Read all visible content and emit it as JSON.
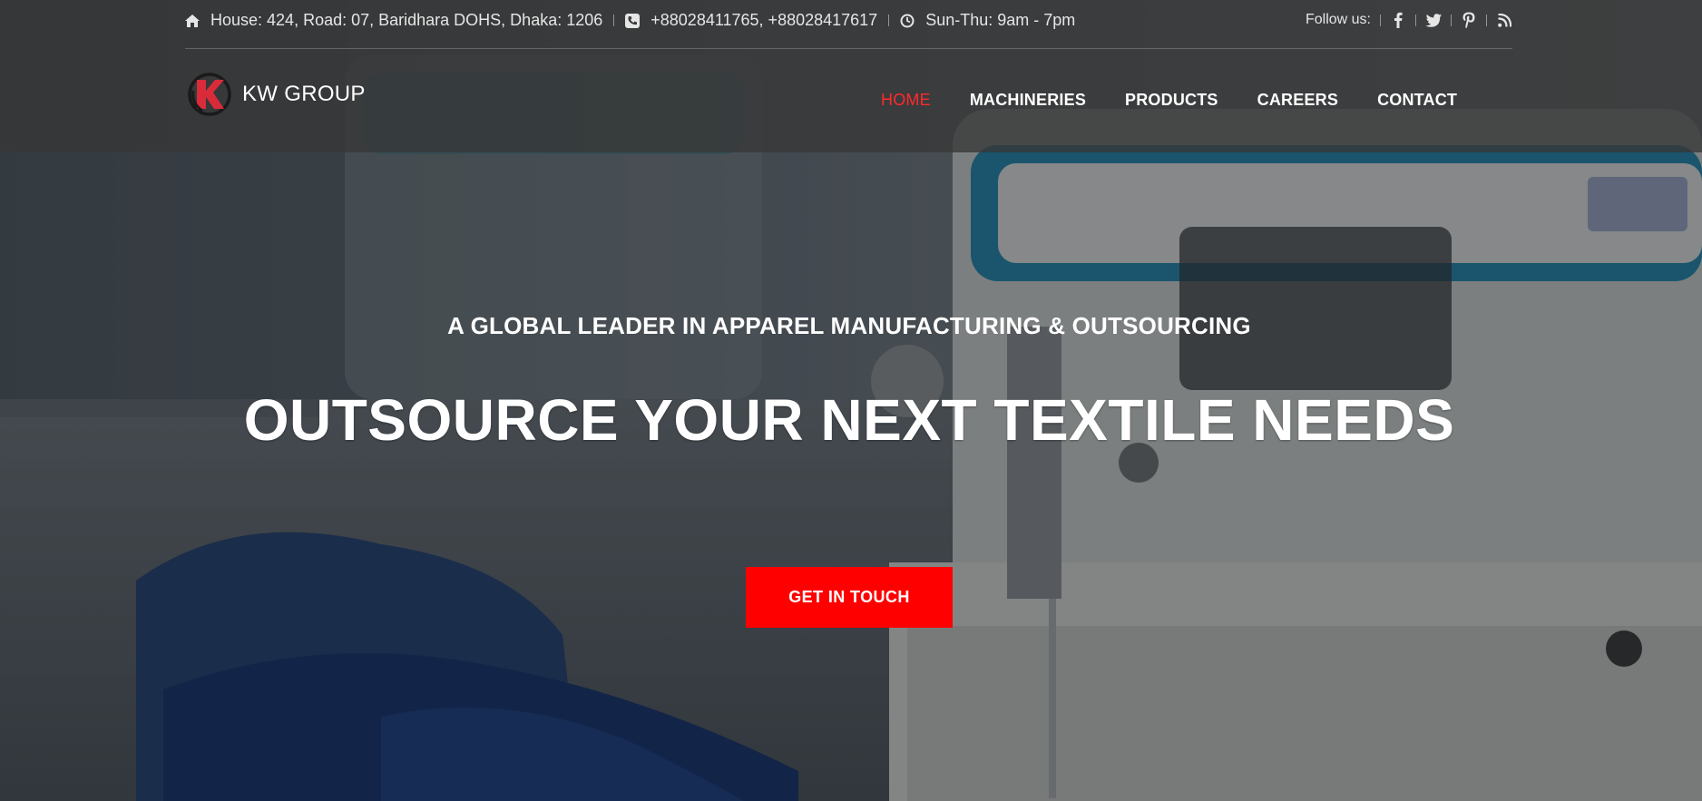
{
  "topbar": {
    "address": "House: 424, Road: 07, Baridhara DOHS, Dhaka: 1206",
    "phone": "+88028411765, +88028417617",
    "hours": "Sun-Thu: 9am - 7pm",
    "follow_label": "Follow us:",
    "icons": [
      "home-icon",
      "phone-icon",
      "clock-icon"
    ],
    "social": [
      "facebook-icon",
      "twitter-icon",
      "pinterest-icon",
      "rss-icon"
    ]
  },
  "brand": {
    "name": "KW GROUP",
    "logo_icon": "kw-logo-icon",
    "logo_letter": "K"
  },
  "nav": {
    "items": [
      "HOME",
      "MACHINERIES",
      "PRODUCTS",
      "CAREERS",
      "CONTACT"
    ],
    "active_index": 0
  },
  "hero": {
    "tagline": "A GLOBAL LEADER IN APPAREL MANUFACTURING & OUTSOURCING",
    "headline": "OUTSOURCE YOUR NEXT TEXTILE NEEDS",
    "cta_label": "GET IN TOUCH",
    "background": "sewing-machine-photo"
  },
  "colors": {
    "accent": "#ff0000",
    "nav_active": "#ff2a2a",
    "header_bg": "#373737"
  }
}
